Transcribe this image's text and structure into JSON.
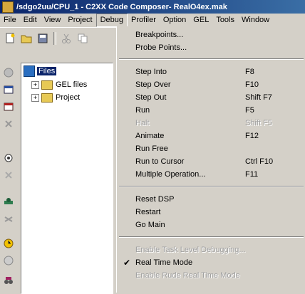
{
  "title": "/sdgo2uu/CPU_1 - C2XX Code Composer- RealO4ex.mak",
  "menubar": [
    "File",
    "Edit",
    "View",
    "Project",
    "Debug",
    "Profiler",
    "Option",
    "GEL",
    "Tools",
    "Window"
  ],
  "tree": {
    "root": "Files",
    "items": [
      "GEL files",
      "Project"
    ]
  },
  "debug_menu": {
    "items": [
      {
        "label": "Breakpoints...",
        "shortcut": "",
        "enabled": true
      },
      {
        "label": "Probe Points...",
        "shortcut": "",
        "enabled": true
      },
      {
        "label": "Step Into",
        "shortcut": "F8",
        "enabled": true
      },
      {
        "label": "Step Over",
        "shortcut": "F10",
        "enabled": true
      },
      {
        "label": "Step Out",
        "shortcut": "Shift F7",
        "enabled": true
      },
      {
        "label": "Run",
        "shortcut": "F5",
        "enabled": true
      },
      {
        "label": "Halt",
        "shortcut": "Shift F5",
        "enabled": false
      },
      {
        "label": "Animate",
        "shortcut": "F12",
        "enabled": true
      },
      {
        "label": "Run Free",
        "shortcut": "",
        "enabled": true
      },
      {
        "label": "Run to Cursor",
        "shortcut": "Ctrl F10",
        "enabled": true
      },
      {
        "label": "Multiple Operation...",
        "shortcut": "F11",
        "enabled": true
      },
      {
        "label": "Reset DSP",
        "shortcut": "",
        "enabled": true
      },
      {
        "label": "Restart",
        "shortcut": "",
        "enabled": true
      },
      {
        "label": "Go Main",
        "shortcut": "",
        "enabled": true
      },
      {
        "label": "Enable Task Level Debugging...",
        "shortcut": "",
        "enabled": false
      },
      {
        "label": "Real Time Mode",
        "shortcut": "",
        "enabled": true,
        "checked": true
      },
      {
        "label": "Enable Rude Real Time Mode",
        "shortcut": "",
        "enabled": false
      }
    ]
  }
}
